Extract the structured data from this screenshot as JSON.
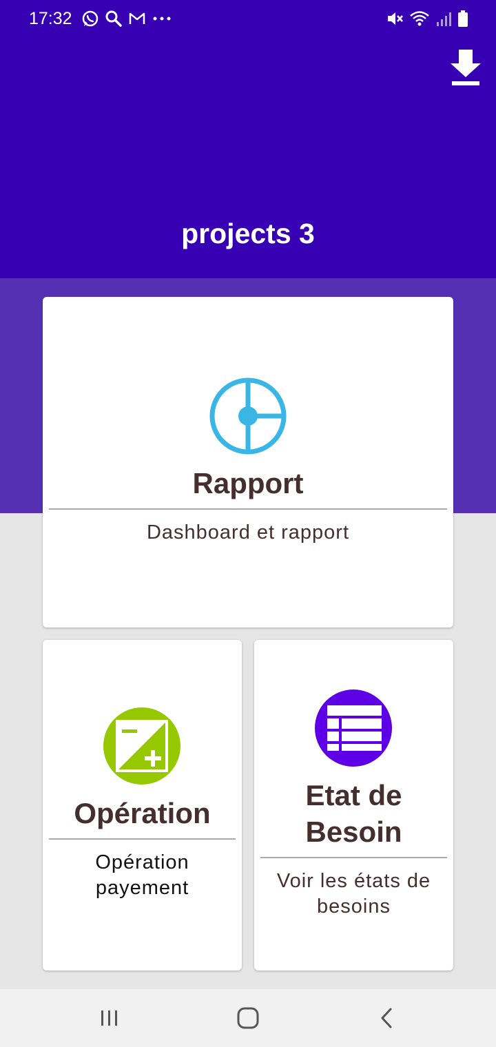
{
  "status_bar": {
    "time": "17:32",
    "left_icons": [
      "whatsapp-icon",
      "search-icon",
      "gmail-icon",
      "more-icon"
    ],
    "right_icons": [
      "mute-icon",
      "wifi-icon",
      "signal-icon",
      "battery-icon"
    ]
  },
  "header": {
    "title": "projects 3",
    "download_icon": "download-icon",
    "background": "#3700b3",
    "band_color": "#5530b3"
  },
  "cards": {
    "rapport": {
      "title": "Rapport",
      "subtitle": "Dashboard et rapport",
      "icon": "chart-icon",
      "icon_color": "#39b5e6"
    },
    "operation": {
      "title": "Opération",
      "subtitle_line1": "Opération",
      "subtitle_line2": "payement",
      "icon": "plus-minus-icon",
      "icon_color": "#96c800"
    },
    "besoin": {
      "title_line1": "Etat de",
      "title_line2": "Besoin",
      "subtitle_line1": "Voir les états de",
      "subtitle_line2": "besoins",
      "icon": "table-list-icon",
      "icon_color": "#5d00e6"
    }
  },
  "nav_bar": {
    "buttons": [
      "recent-apps-icon",
      "home-icon",
      "back-icon"
    ]
  }
}
